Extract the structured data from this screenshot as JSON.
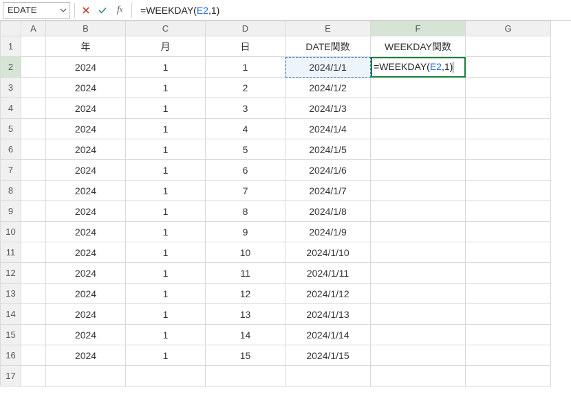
{
  "namebox": {
    "value": "EDATE"
  },
  "formula_bar": {
    "prefix": "=",
    "func_open": "WEEKDAY(",
    "ref": "E2",
    "sep_num_close": ",1)"
  },
  "columns": [
    "A",
    "B",
    "C",
    "D",
    "E",
    "F",
    "G"
  ],
  "col_widths": {
    "A": "col-A",
    "B": "col-B",
    "C": "col-C",
    "D": "col-D",
    "E": "col-E",
    "F": "col-F",
    "G": "col-G"
  },
  "headers": {
    "B": "年",
    "C": "月",
    "D": "日",
    "E": "DATE関数",
    "F": "WEEKDAY関数"
  },
  "rows": [
    {
      "n": 1,
      "B": "年",
      "C": "月",
      "D": "日",
      "E": "DATE関数",
      "F": "WEEKDAY関数",
      "is_header": true
    },
    {
      "n": 2,
      "B": "2024",
      "C": "1",
      "D": "1",
      "E": "2024/1/1",
      "F_edit": true
    },
    {
      "n": 3,
      "B": "2024",
      "C": "1",
      "D": "2",
      "E": "2024/1/2"
    },
    {
      "n": 4,
      "B": "2024",
      "C": "1",
      "D": "3",
      "E": "2024/1/3"
    },
    {
      "n": 5,
      "B": "2024",
      "C": "1",
      "D": "4",
      "E": "2024/1/4"
    },
    {
      "n": 6,
      "B": "2024",
      "C": "1",
      "D": "5",
      "E": "2024/1/5"
    },
    {
      "n": 7,
      "B": "2024",
      "C": "1",
      "D": "6",
      "E": "2024/1/6"
    },
    {
      "n": 8,
      "B": "2024",
      "C": "1",
      "D": "7",
      "E": "2024/1/7"
    },
    {
      "n": 9,
      "B": "2024",
      "C": "1",
      "D": "8",
      "E": "2024/1/8"
    },
    {
      "n": 10,
      "B": "2024",
      "C": "1",
      "D": "9",
      "E": "2024/1/9"
    },
    {
      "n": 11,
      "B": "2024",
      "C": "1",
      "D": "10",
      "E": "2024/1/10"
    },
    {
      "n": 12,
      "B": "2024",
      "C": "1",
      "D": "11",
      "E": "2024/1/11"
    },
    {
      "n": 13,
      "B": "2024",
      "C": "1",
      "D": "12",
      "E": "2024/1/12"
    },
    {
      "n": 14,
      "B": "2024",
      "C": "1",
      "D": "13",
      "E": "2024/1/13"
    },
    {
      "n": 15,
      "B": "2024",
      "C": "1",
      "D": "14",
      "E": "2024/1/14"
    },
    {
      "n": 16,
      "B": "2024",
      "C": "1",
      "D": "15",
      "E": "2024/1/15"
    },
    {
      "n": 17
    }
  ],
  "editing_formula": {
    "prefix": "=",
    "func_open": "WEEKDAY(",
    "ref": "E2",
    "sep": ",",
    "num": "1",
    "close": ")"
  },
  "active": {
    "col": "F",
    "row": 2,
    "ref_cell": "E2"
  }
}
